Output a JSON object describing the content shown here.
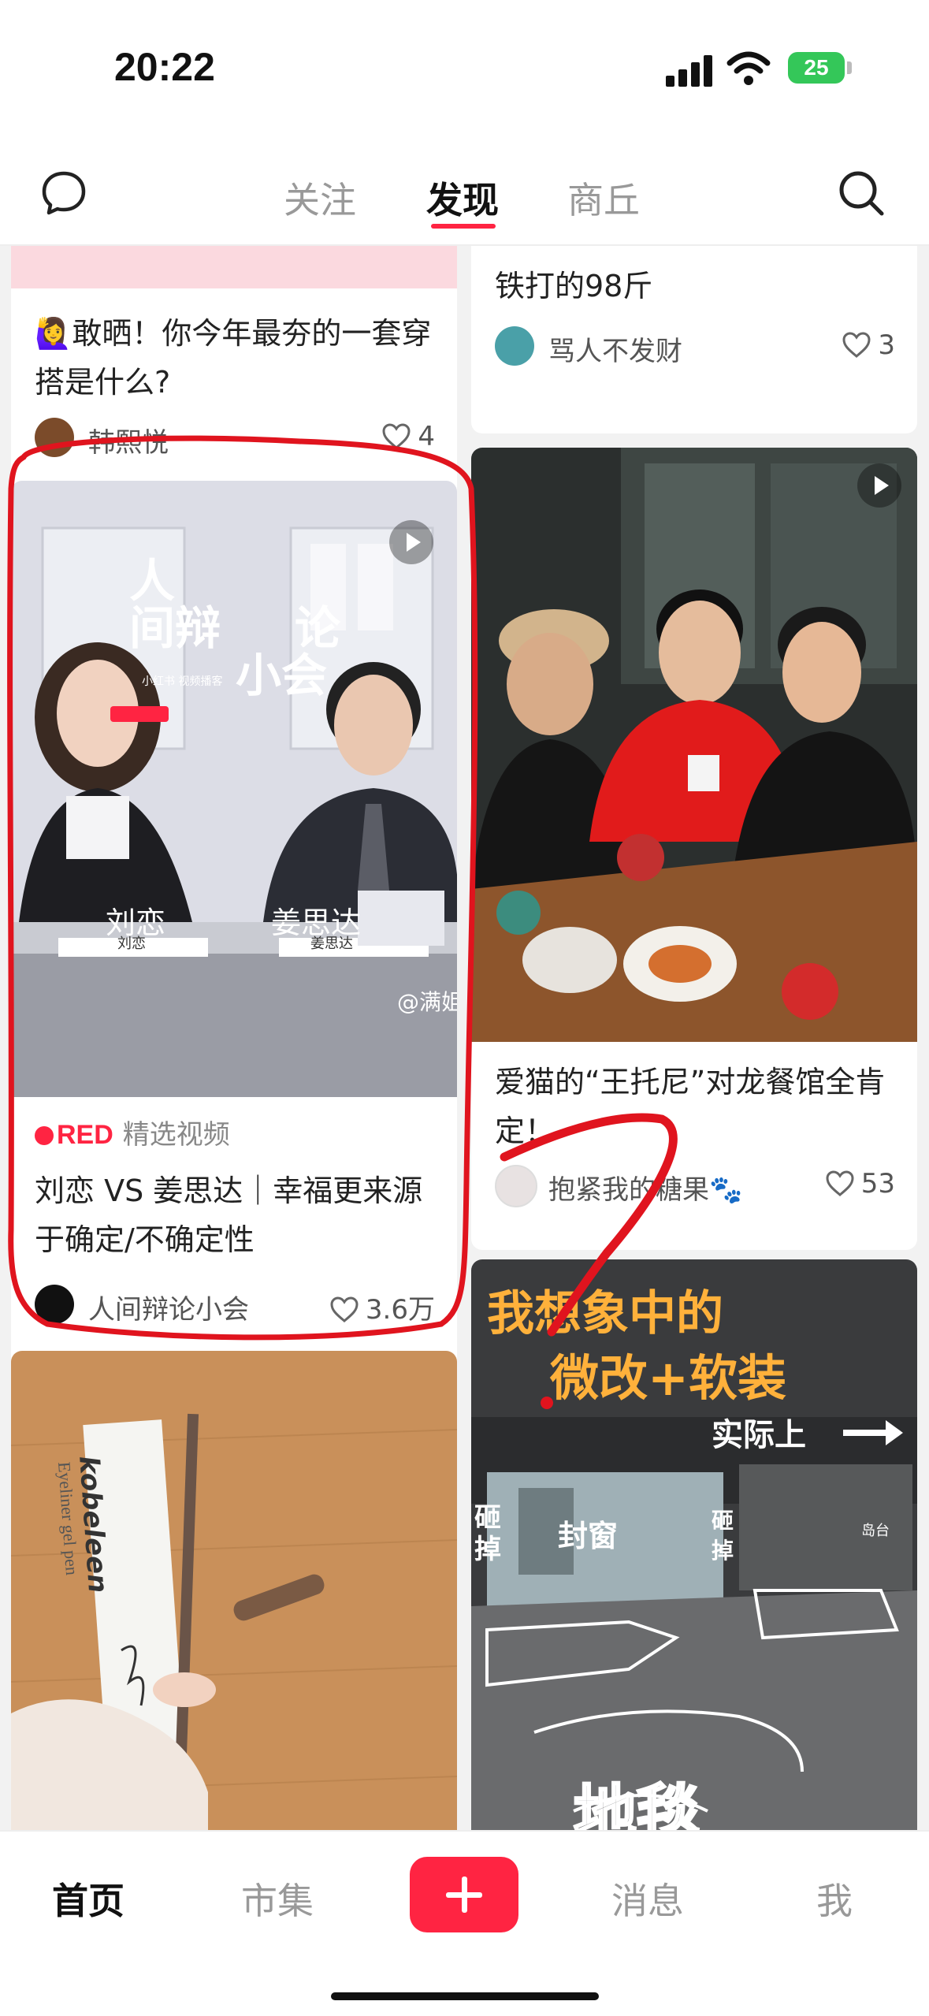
{
  "status_bar": {
    "time": "20:22",
    "battery": "25"
  },
  "top_nav": {
    "tabs": [
      {
        "label": "关注"
      },
      {
        "label": "发现"
      },
      {
        "label": "商丘"
      }
    ],
    "active_tab": "发现",
    "left_icon": "chat-bubble-icon",
    "right_icon": "search-icon"
  },
  "feed": {
    "left": [
      {
        "title": "🙋‍♀️敢晒！你今年最夯的一套穿搭是什么?",
        "author": "韩熙悦",
        "likes": "4"
      },
      {
        "image_text": {
          "show_line1": "人",
          "show_line2a": "间辩",
          "show_line2b": "论",
          "show_line3": "小会",
          "show_badge": "小红书 视频播客",
          "name_left": "刘恋",
          "name_right": "姜思达",
          "plate_left": "刘恋",
          "plate_right": "姜思达",
          "watermark": "@满姐er"
        },
        "tag_red": "RED",
        "tag_sub": "精选视频",
        "title": "刘恋 VS 姜思达｜幸福更来源于确定/不确定性",
        "author": "人间辩论小会",
        "likes": "3.6万"
      },
      {
        "image_text": {
          "brand": "kobeleen",
          "product": "Eyeliner gel pen"
        }
      }
    ],
    "right": [
      {
        "title": "铁打的98斤",
        "author": "骂人不发财",
        "likes": "3"
      },
      {
        "title": "爱猫的“王托尼”对龙餐馆全肯定！",
        "author": "抱紧我的糖果🐾",
        "likes": "53"
      },
      {
        "image_text": {
          "headline1": "我想象中的",
          "headline2": "微改+软装",
          "actual": "实际上",
          "label_a": "砸",
          "label_a2": "掉",
          "label_b": "封窗",
          "label_c": "砸",
          "label_c2": "掉",
          "label_d": "岛台",
          "floor": "地毯"
        }
      }
    ]
  },
  "bottom_nav": {
    "items": [
      {
        "label": "首页"
      },
      {
        "label": "市集"
      },
      {
        "label": "消息"
      },
      {
        "label": "我"
      }
    ],
    "active": "首页"
  },
  "colors": {
    "accent": "#ff2442",
    "annotation": "#e0141e"
  }
}
